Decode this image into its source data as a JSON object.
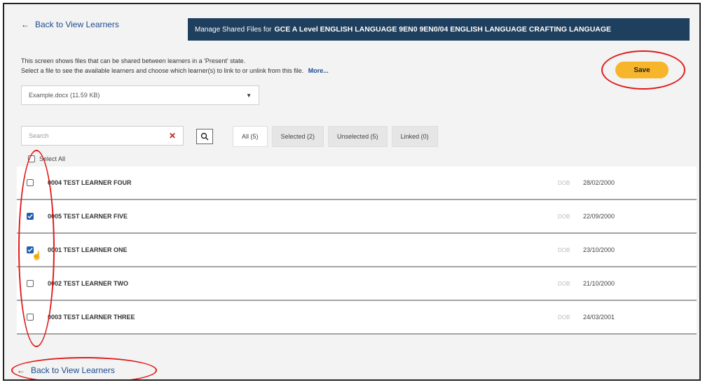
{
  "nav": {
    "back_label": "Back to View Learners"
  },
  "header": {
    "prefix": "Manage Shared Files for",
    "title": "GCE A Level ENGLISH LANGUAGE 9EN0 9EN0/04 ENGLISH LANGUAGE CRAFTING LANGUAGE"
  },
  "intro": {
    "line1": "This screen shows files that can be shared between learners in a 'Present' state.",
    "line2": "Select a file to see the available learners and choose which learner(s) to link to or unlink from this file.",
    "more": "More..."
  },
  "save": {
    "label": "Save"
  },
  "file_select": {
    "value": "Example.docx (11.59 KB)"
  },
  "search": {
    "placeholder": "Search"
  },
  "filters": [
    {
      "label": "All (5)",
      "active": true
    },
    {
      "label": "Selected (2)",
      "active": false
    },
    {
      "label": "Unselected (5)",
      "active": false
    },
    {
      "label": "Linked (0)",
      "active": false
    }
  ],
  "select_all": {
    "label": "Select All"
  },
  "learners": [
    {
      "name": "0004 TEST LEARNER FOUR",
      "dob_label": "DOB",
      "dob": "28/02/2000",
      "checked": false
    },
    {
      "name": "0005 TEST LEARNER FIVE",
      "dob_label": "DOB",
      "dob": "22/09/2000",
      "checked": true
    },
    {
      "name": "0001 TEST LEARNER ONE",
      "dob_label": "DOB",
      "dob": "23/10/2000",
      "checked": true
    },
    {
      "name": "0002 TEST LEARNER TWO",
      "dob_label": "DOB",
      "dob": "21/10/2000",
      "checked": false
    },
    {
      "name": "0003 TEST LEARNER THREE",
      "dob_label": "DOB",
      "dob": "24/03/2001",
      "checked": false
    }
  ],
  "colors": {
    "banner": "#1f3f5e",
    "save": "#f7b52b",
    "annotation": "#e01b1b",
    "link": "#1c4b8f",
    "checkbox": "#1f5fb0"
  }
}
